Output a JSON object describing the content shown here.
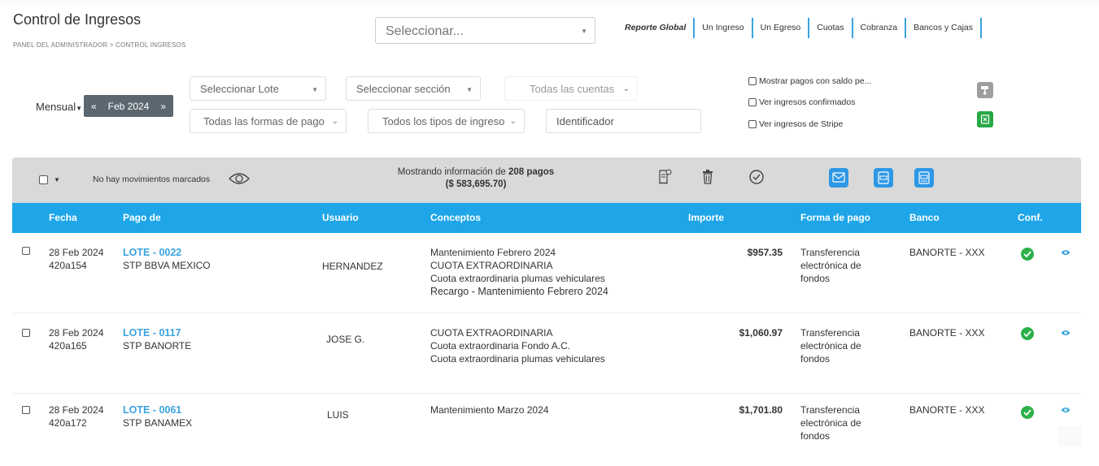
{
  "header": {
    "title": "Control de Ingresos",
    "breadcrumb": "PANEL DEL ADMINISTRADOR > CONTROL INGRESOS",
    "main_select_placeholder": "Seleccionar..."
  },
  "nav_links": [
    {
      "label": "Reporte Global",
      "active": true
    },
    {
      "label": "Un Ingreso",
      "active": false
    },
    {
      "label": "Un Egreso",
      "active": false
    },
    {
      "label": "Cuotas",
      "active": false
    },
    {
      "label": "Cobranza",
      "active": false
    },
    {
      "label": "Bancos y Cajas",
      "active": false
    }
  ],
  "filters": {
    "period_label": "Mensual",
    "month_prev": "«",
    "month_label": "Feb 2024",
    "month_next": "»",
    "lote": "Seleccionar Lote",
    "seccion": "Seleccionar sección",
    "cuentas": "Todas las cuentas",
    "formas_pago": "Todas las formas de pago",
    "tipos_ingreso": "Todos los tipos de ingreso",
    "identificador_placeholder": "Identificador",
    "check_saldo": "Mostrar pagos con saldo pe...",
    "check_confirmados": "Ver ingresos confirmados",
    "check_stripe": "Ver ingresos de Stripe"
  },
  "toolbar": {
    "marked_text": "No hay movimientos marcados",
    "info_prefix": "Mostrando información de ",
    "info_count": "208 pagos",
    "info_total": "($ 583,695.70)"
  },
  "table": {
    "headers": {
      "fecha": "Fecha",
      "pago_de": "Pago de",
      "usuario": "Usuario",
      "conceptos": "Conceptos",
      "importe": "Importe",
      "forma_pago": "Forma de pago",
      "banco": "Banco",
      "conf": "Conf."
    },
    "rows": [
      {
        "fecha": "28 Feb 2024",
        "id": "420a154",
        "lote": "LOTE - 0022",
        "banco_origen": "STP BBVA MEXICO",
        "usuario": "HERNANDEZ",
        "conceptos": [
          "Mantenimiento Febrero 2024",
          "CUOTA EXTRAORDINARIA",
          "Cuota extraordinaria plumas vehiculares",
          "Recargo -  Mantenimiento Febrero 2024"
        ],
        "importe": "$957.35",
        "forma_pago": [
          "Transferencia",
          "electrónica de",
          "fondos"
        ],
        "banco": "BANORTE - XXX"
      },
      {
        "fecha": "28 Feb 2024",
        "id": "420a165",
        "lote": "LOTE - 0117",
        "banco_origen": "STP BANORTE",
        "usuario": "JOSE G.",
        "conceptos": [
          "CUOTA EXTRAORDINARIA",
          "Cuota extraordinaria Fondo A.C.",
          "Cuota extraordinaria plumas vehiculares"
        ],
        "importe": "$1,060.97",
        "forma_pago": [
          "Transferencia",
          "electrónica de",
          "fondos"
        ],
        "banco": "BANORTE - XXX"
      },
      {
        "fecha": "28 Feb 2024",
        "id": "420a172",
        "lote": "LOTE - 0061",
        "banco_origen": "STP BANAMEX",
        "usuario": "LUIS",
        "conceptos": [
          "Mantenimiento Marzo 2024"
        ],
        "importe": "$1,701.80",
        "forma_pago": [
          "Transferencia",
          "electrónica de",
          "fondos"
        ],
        "banco": "BANORTE - XXX"
      }
    ]
  },
  "colors": {
    "accent_blue": "#1ea6e9",
    "link_blue": "#3aa3e0",
    "confirm_green": "#2bb04a",
    "excel_green": "#28a745",
    "toolbar_gray": "#d9d9d9",
    "month_box": "#5b6770"
  }
}
